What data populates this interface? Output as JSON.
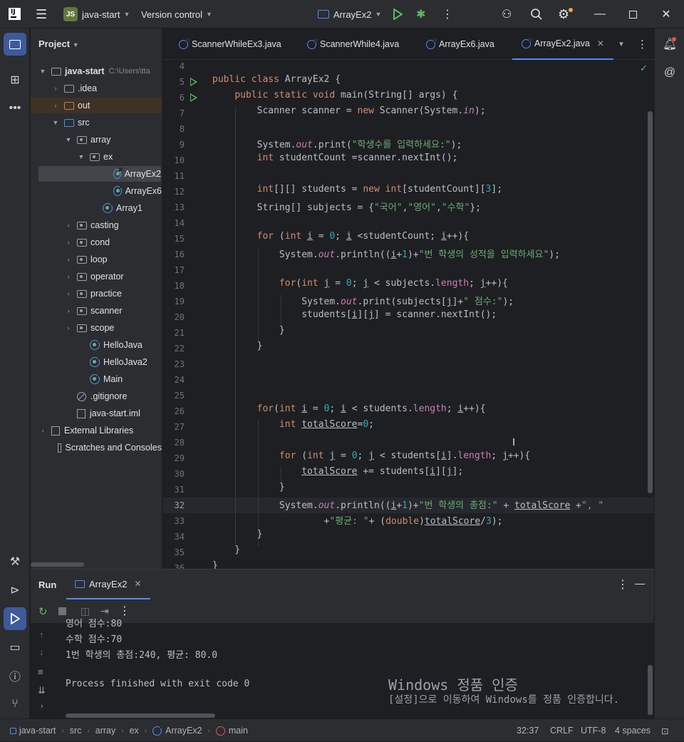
{
  "titlebar": {
    "project_badge": "JS",
    "project_name": "java-start",
    "vcs": "Version control",
    "run_config": "ArrayEx2"
  },
  "project_panel": {
    "title": "Project",
    "root": "java-start",
    "root_path": "C:\\Users\\tta",
    "items": [
      {
        "label": ".idea",
        "type": "folder"
      },
      {
        "label": "out",
        "type": "folder-excluded"
      },
      {
        "label": "src",
        "type": "source-folder"
      },
      {
        "label": "array",
        "type": "package"
      },
      {
        "label": "ex",
        "type": "package"
      },
      {
        "label": "ArrayEx2",
        "type": "class",
        "selected": true
      },
      {
        "label": "ArrayEx6",
        "type": "class"
      },
      {
        "label": "Array1",
        "type": "class"
      },
      {
        "label": "casting",
        "type": "package"
      },
      {
        "label": "cond",
        "type": "package"
      },
      {
        "label": "loop",
        "type": "package"
      },
      {
        "label": "operator",
        "type": "package"
      },
      {
        "label": "practice",
        "type": "package"
      },
      {
        "label": "scanner",
        "type": "package"
      },
      {
        "label": "scope",
        "type": "package"
      },
      {
        "label": "HelloJava",
        "type": "class"
      },
      {
        "label": "HelloJava2",
        "type": "class"
      },
      {
        "label": "Main",
        "type": "class"
      },
      {
        "label": ".gitignore",
        "type": "ignore"
      },
      {
        "label": "java-start.iml",
        "type": "file"
      },
      {
        "label": "External Libraries",
        "type": "libraries"
      },
      {
        "label": "Scratches and Consoles",
        "type": "scratches"
      }
    ]
  },
  "tabs": [
    {
      "label": "ScannerWhileEx3.java"
    },
    {
      "label": "ScannerWhile4.java"
    },
    {
      "label": "ArrayEx6.java"
    },
    {
      "label": "ArrayEx2.java",
      "active": true
    }
  ],
  "editor": {
    "line_numbers": [
      "4",
      "5",
      "6",
      "7",
      "8",
      "9",
      "10",
      "11",
      "12",
      "13",
      "14",
      "15",
      "16",
      "17",
      "18",
      "19",
      "20",
      "21",
      "22",
      "23",
      "24",
      "25",
      "26",
      "27",
      "28",
      "29",
      "30",
      "31",
      "32",
      "33",
      "34",
      "35",
      "36"
    ],
    "current_line": "32"
  },
  "run_panel": {
    "title": "Run",
    "tab": "ArrayEx2",
    "console_lines": [
      "영어 점수:80",
      "수학 점수:70",
      "1번 학생의 총점:240, 평균: 80.0",
      "",
      "Process finished with exit code 0"
    ],
    "watermark_title": "Windows 정품 인증",
    "watermark_sub": "[설정]으로 이동하여 Windows를 정품 인증합니다."
  },
  "statusbar": {
    "breadcrumbs": [
      "java-start",
      "src",
      "array",
      "ex",
      "ArrayEx2",
      "main"
    ],
    "position": "32:37",
    "line_sep": "CRLF",
    "encoding": "UTF-8",
    "indent": "4 spaces"
  }
}
